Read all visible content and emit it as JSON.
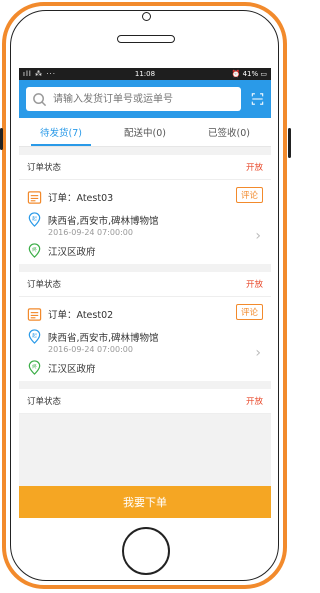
{
  "status": {
    "signal": "ıll ⁂ ···",
    "time": "11:08",
    "battery": "⏰ 41% ▭"
  },
  "search": {
    "placeholder": "请输入发货订单号或运单号"
  },
  "tabs": [
    {
      "label": "待发货(7)"
    },
    {
      "label": "配送中(0)"
    },
    {
      "label": "已签收(0)"
    }
  ],
  "orders": [
    {
      "status_label": "订单状态",
      "state": "开放",
      "order": "订单：Atest03",
      "review": "评论",
      "from": "陕西省,西安市,碑林博物馆",
      "date": "2016-09-24 07:00:00",
      "to": "江汉区政府"
    },
    {
      "status_label": "订单状态",
      "state": "开放",
      "order": "订单：Atest02",
      "review": "评论",
      "from": "陕西省,西安市,碑林博物馆",
      "date": "2016-09-24 07:00:00",
      "to": "江汉区政府"
    },
    {
      "status_label": "订单状态",
      "state": "开放"
    }
  ],
  "footer": {
    "place_order": "我要下单"
  },
  "colors": {
    "phone_frame": "#f28a2c",
    "accent": "#2a9ae8",
    "button": "#f5a623",
    "state": "#e84a2c"
  }
}
